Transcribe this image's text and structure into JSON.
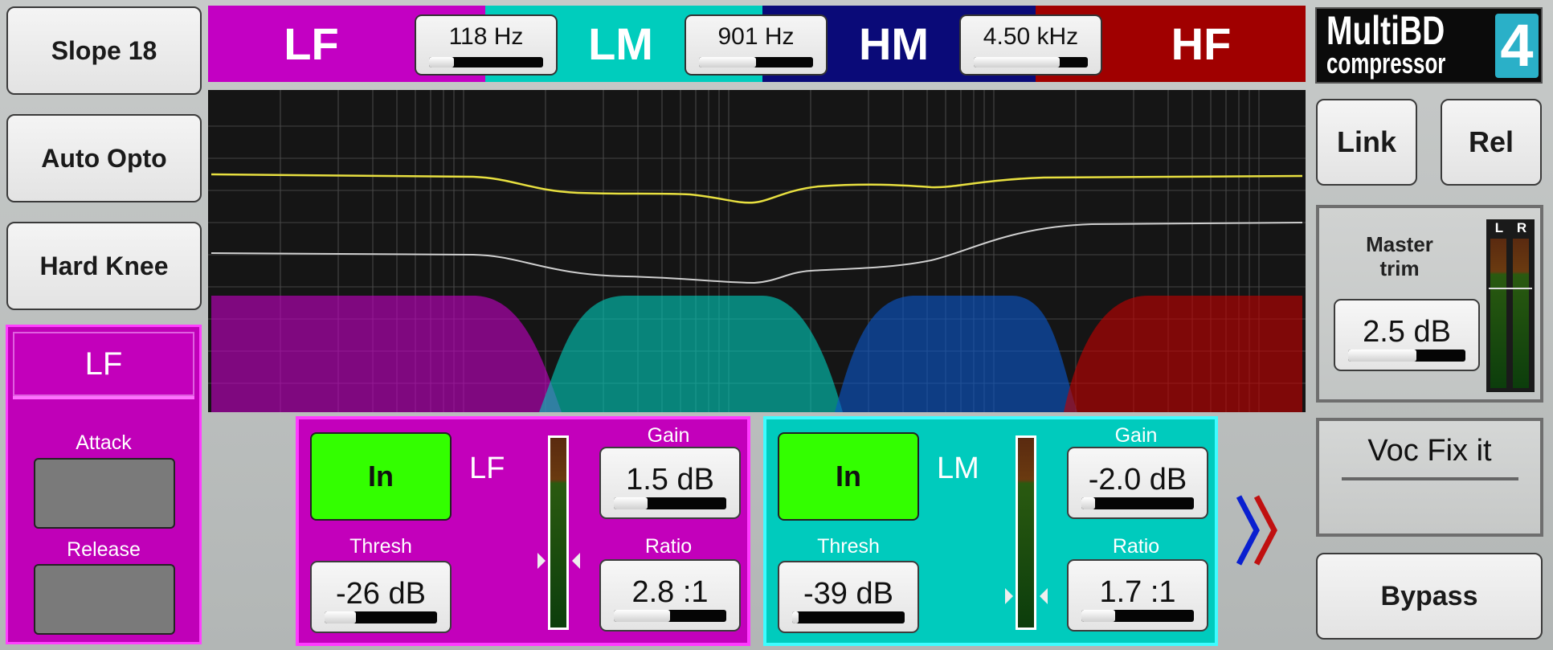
{
  "left_buttons": {
    "slope": "Slope 18",
    "auto": "Auto Opto",
    "knee": "Hard Knee"
  },
  "band_header": {
    "bands": [
      {
        "label": "LF",
        "color": "#c300c3"
      },
      {
        "label": "LM",
        "color": "#00cdbd"
      },
      {
        "label": "HM",
        "color": "#0a0a78"
      },
      {
        "label": "HF",
        "color": "#a00000"
      }
    ],
    "crossovers": [
      {
        "value": "118 Hz",
        "level": 0.22
      },
      {
        "value": "901 Hz",
        "level": 0.5
      },
      {
        "value": "4.50 kHz",
        "level": 0.75
      }
    ]
  },
  "logo": {
    "line1": "MultiBD",
    "line2": "compressor",
    "number": "4"
  },
  "right_buttons": {
    "link": "Link",
    "rel": "Rel",
    "bypass": "Bypass"
  },
  "master": {
    "label_line1": "Master",
    "label_line2": "trim",
    "value": "2.5 dB",
    "level": 0.58,
    "meter_l": "L",
    "meter_r": "R"
  },
  "preset": {
    "name": "Voc Fix it"
  },
  "band_select": {
    "label": "LF",
    "attack": "Attack",
    "release": "Release"
  },
  "panels": [
    {
      "in": "In",
      "name": "LF",
      "gain_label": "Gain",
      "gain": "1.5 dB",
      "gain_level": 0.3,
      "thresh_label": "Thresh",
      "thresh": "-26 dB",
      "thresh_level": 0.28,
      "ratio_label": "Ratio",
      "ratio": "2.8 :1",
      "ratio_level": 0.5
    },
    {
      "in": "In",
      "name": "LM",
      "gain_label": "Gain",
      "gain": "-2.0 dB",
      "gain_level": 0.12,
      "thresh_label": "Thresh",
      "thresh": "-39 dB",
      "thresh_level": 0.06,
      "ratio_label": "Ratio",
      "ratio": "1.7 :1",
      "ratio_level": 0.3
    }
  ],
  "next_icon": "chevron-right-icon"
}
